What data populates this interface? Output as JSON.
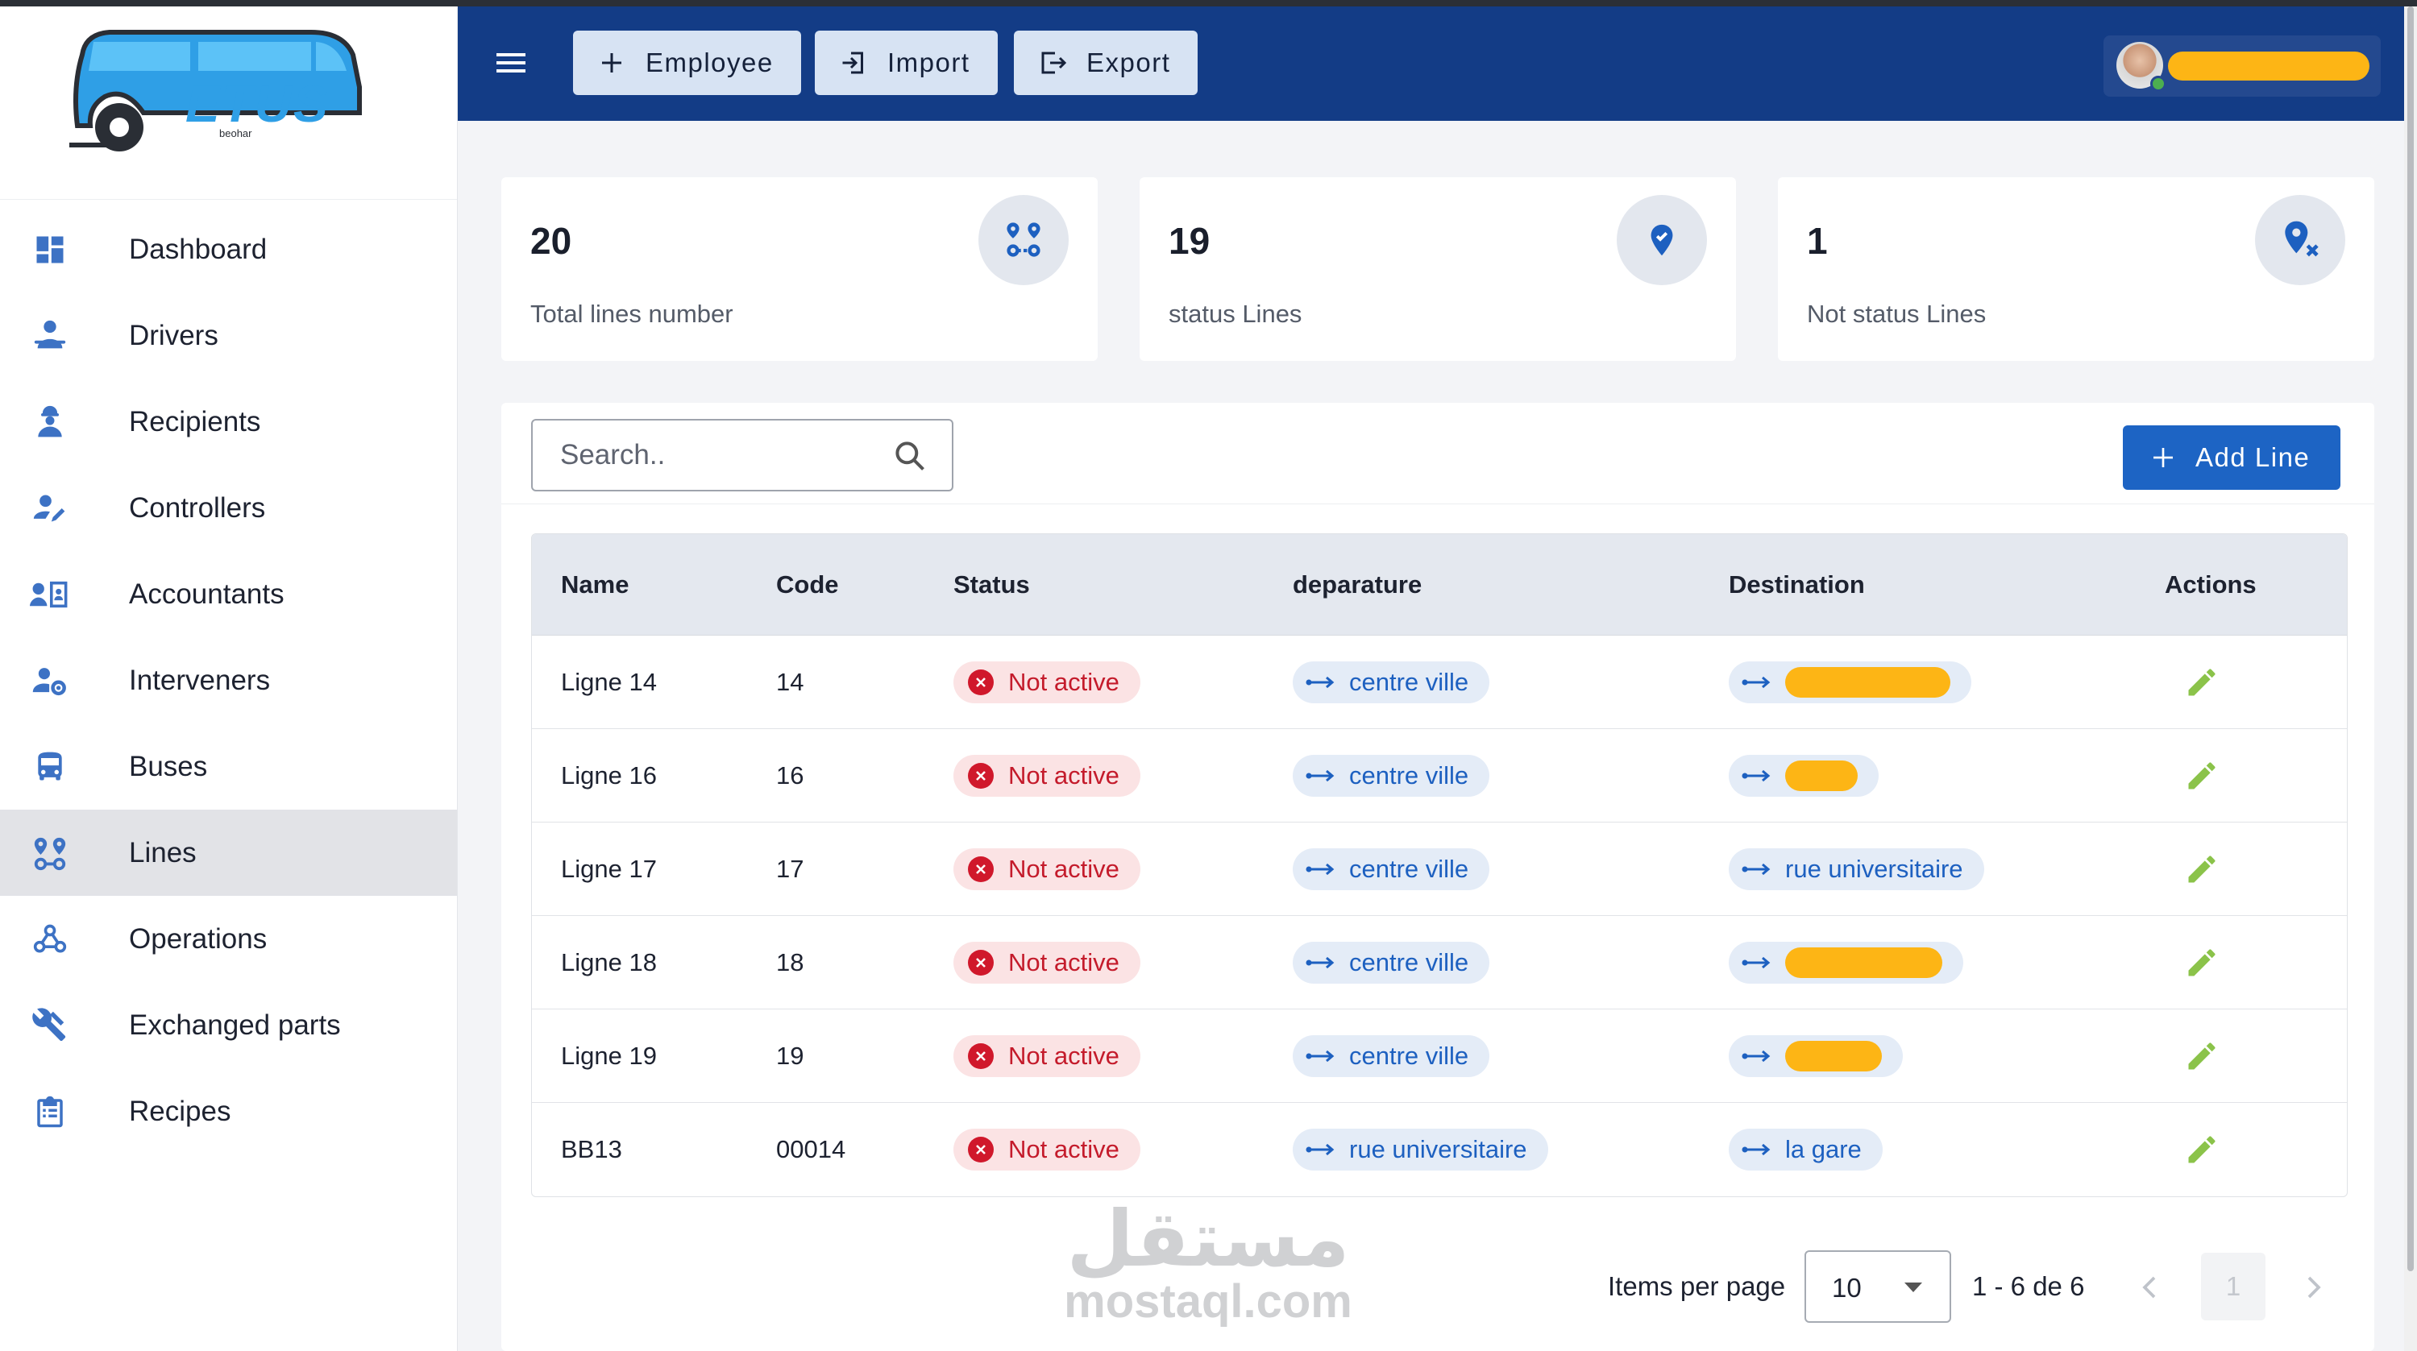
{
  "brand": {
    "logo_text": "ETUS",
    "logo_subtext": "beohar"
  },
  "sidebar": {
    "items": [
      {
        "label": "Dashboard",
        "icon": "dashboard-icon",
        "active": false
      },
      {
        "label": "Drivers",
        "icon": "driver-icon",
        "active": false
      },
      {
        "label": "Recipients",
        "icon": "worker-icon",
        "active": false
      },
      {
        "label": "Controllers",
        "icon": "user-edit-icon",
        "active": false
      },
      {
        "label": "Accountants",
        "icon": "contact-card-icon",
        "active": false
      },
      {
        "label": "Interveners",
        "icon": "user-gear-icon",
        "active": false
      },
      {
        "label": "Buses",
        "icon": "bus-icon",
        "active": false
      },
      {
        "label": "Lines",
        "icon": "route-icon",
        "active": true
      },
      {
        "label": "Operations",
        "icon": "webhook-icon",
        "active": false
      },
      {
        "label": "Exchanged parts",
        "icon": "tools-icon",
        "active": false
      },
      {
        "label": "Recipes",
        "icon": "clipboard-icon",
        "active": false
      }
    ]
  },
  "header": {
    "buttons": [
      {
        "label": "Employee",
        "icon": "plus-icon"
      },
      {
        "label": "Import",
        "icon": "import-icon"
      },
      {
        "label": "Export",
        "icon": "export-icon"
      }
    ]
  },
  "stats": [
    {
      "value": "20",
      "label": "Total lines number",
      "icon": "route-icon"
    },
    {
      "value": "19",
      "label": "status Lines",
      "icon": "verified-pin-icon"
    },
    {
      "value": "1",
      "label": "Not status Lines",
      "icon": "location-off-icon"
    }
  ],
  "search": {
    "placeholder": "Search.."
  },
  "add_button": {
    "label": "Add Line"
  },
  "table": {
    "columns": [
      "Name",
      "Code",
      "Status",
      "deparature",
      "Destination",
      "Actions"
    ],
    "rows": [
      {
        "name": "Ligne 14",
        "code": "14",
        "status": "Not active",
        "departure": "centre ville",
        "destination": "",
        "dest_redacted": true
      },
      {
        "name": "Ligne 16",
        "code": "16",
        "status": "Not active",
        "departure": "centre ville",
        "destination": "",
        "dest_redacted": true
      },
      {
        "name": "Ligne 17",
        "code": "17",
        "status": "Not active",
        "departure": "centre ville",
        "destination": "rue universitaire",
        "dest_redacted": false
      },
      {
        "name": "Ligne 18",
        "code": "18",
        "status": "Not active",
        "departure": "centre ville",
        "destination": "",
        "dest_redacted": true
      },
      {
        "name": "Ligne 19",
        "code": "19",
        "status": "Not active",
        "departure": "centre ville",
        "destination": "",
        "dest_redacted": true
      },
      {
        "name": "BB13",
        "code": "00014",
        "status": "Not active",
        "departure": "rue universitaire",
        "destination": "la gare",
        "dest_redacted": false
      }
    ]
  },
  "pagination": {
    "items_per_page_label": "Items per page",
    "page_size": "10",
    "range": "1 - 6 de 6",
    "current_page": "1"
  },
  "watermark": {
    "arabic": "مستقل",
    "latin": "mostaql.com"
  },
  "colors": {
    "header": "#133c86",
    "primary": "#1d64c4",
    "danger": "#d0182b",
    "edit": "#8bc34a",
    "redaction": "#fdb515"
  }
}
